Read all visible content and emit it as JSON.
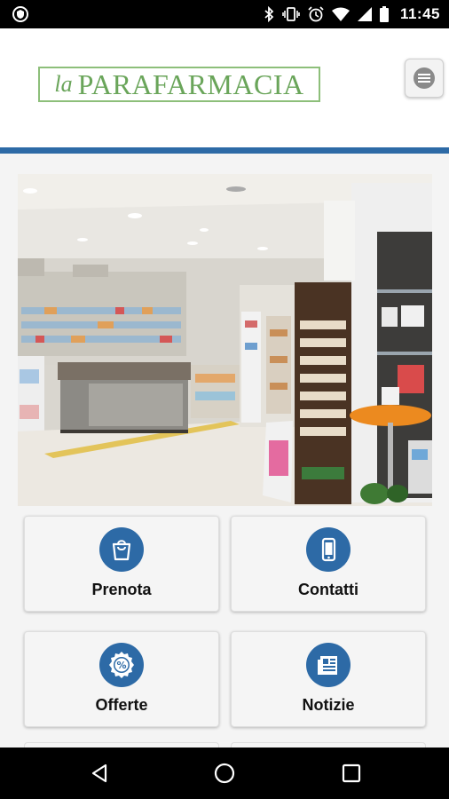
{
  "status_bar": {
    "time": "11:45",
    "icons": [
      "shield-icon",
      "bluetooth-icon",
      "vibrate-icon",
      "alarm-icon",
      "wifi-icon",
      "signal-icon",
      "battery-icon"
    ]
  },
  "header": {
    "logo_prefix": "la",
    "logo_name": "PARAFARMACIA",
    "menu_icon": "menu-icon"
  },
  "colors": {
    "brand_blue": "#2d6aa6",
    "logo_green": "#6aa55a"
  },
  "photo": {
    "subject": "pharmacy-interior-photo"
  },
  "tiles": [
    {
      "label": "Prenota",
      "icon": "shopping-bag-icon"
    },
    {
      "label": "Contatti",
      "icon": "smartphone-icon"
    },
    {
      "label": "Offerte",
      "icon": "percent-badge-icon"
    },
    {
      "label": "Notizie",
      "icon": "newspaper-icon"
    }
  ],
  "nav_bar": {
    "icons": [
      "back-icon",
      "home-icon",
      "recents-icon"
    ]
  }
}
